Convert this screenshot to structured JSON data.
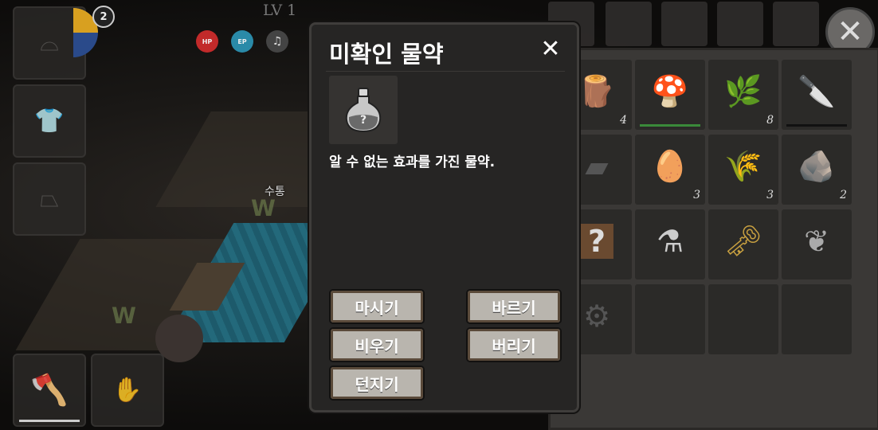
{
  "hud": {
    "level": "LV 1",
    "badge_count": "2",
    "stats": [
      {
        "label": "HP",
        "color": "#c22a2a"
      },
      {
        "label": "EP",
        "color": "#2a8aa8"
      },
      {
        "label": "♫",
        "color": "#444444"
      }
    ],
    "ground_item_label": "수통"
  },
  "modal": {
    "title": "미확인 물약",
    "close": "✕",
    "item_icon": "potion-icon",
    "description": "알 수 없는 효과를 가진 물약.",
    "actions": {
      "drink": "마시기",
      "apply": "바르기",
      "empty": "비우기",
      "discard": "버리기",
      "throw": "던지기"
    }
  },
  "inventory": {
    "close": "✕",
    "items": [
      {
        "name": "log-icon",
        "glyph": "🪵",
        "count": "4"
      },
      {
        "name": "mushroom-icon",
        "glyph": "🍄",
        "count": ""
      },
      {
        "name": "stick-icon",
        "glyph": "🌿",
        "count": "8"
      },
      {
        "name": "knife-icon",
        "glyph": "🔪",
        "count": ""
      },
      {
        "name": "ingot-icon",
        "glyph": "▰",
        "count": ""
      },
      {
        "name": "stone-icon",
        "glyph": "🥚",
        "count": "3"
      },
      {
        "name": "straw-bundle-icon",
        "glyph": "🌾",
        "count": "3"
      },
      {
        "name": "rock-icon",
        "glyph": "🪨",
        "count": "2"
      },
      {
        "name": "unknown-scroll-icon",
        "glyph": "?",
        "count": ""
      },
      {
        "name": "potion-icon",
        "glyph": "⚗",
        "count": ""
      },
      {
        "name": "key-icon",
        "glyph": "🗝",
        "count": ""
      },
      {
        "name": "fire-icon",
        "glyph": "❦",
        "count": ""
      },
      {
        "name": "gear-icon",
        "glyph": "⚙",
        "count": ""
      }
    ]
  }
}
